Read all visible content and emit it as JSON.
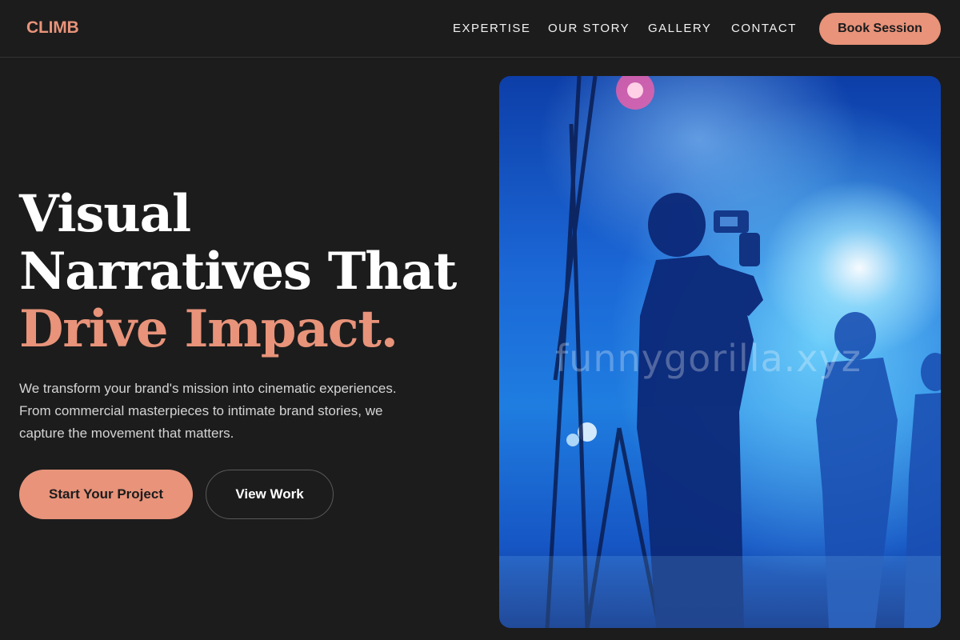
{
  "brand": {
    "logo": "CLIMB",
    "accent_color": "#e8937a"
  },
  "nav": {
    "items": [
      "EXPERTISE",
      "OUR STORY",
      "GALLERY",
      "CONTACT"
    ],
    "cta_label": "Book Session"
  },
  "hero": {
    "title_lines": [
      "Visual",
      "Narratives That",
      "Drive Impact."
    ],
    "description": "We transform your brand's mission into cinematic experiences. From commercial masterpieces to intimate brand stories, we capture the movement that matters.",
    "primary_button": "Start Your Project",
    "secondary_button": "View Work"
  },
  "image": {
    "watermark": "funnygorilla.xyz"
  }
}
